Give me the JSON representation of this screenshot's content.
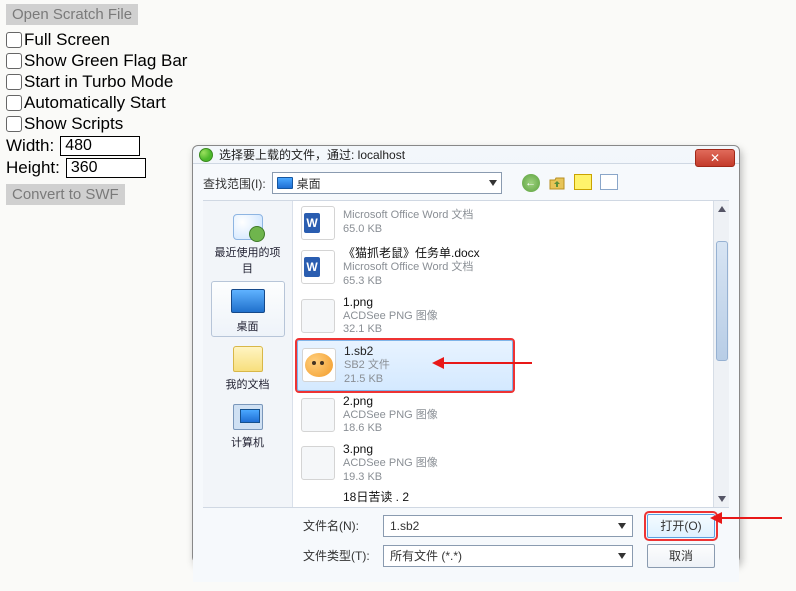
{
  "left": {
    "open_scratch": "Open Scratch File",
    "checkboxes": [
      "Full Screen",
      "Show Green Flag Bar",
      "Start in Turbo Mode",
      "Automatically Start",
      "Show Scripts"
    ],
    "width_label": "Width:",
    "width_value": "480",
    "height_label": "Height:",
    "height_value": "360",
    "convert": "Convert to SWF"
  },
  "dialog": {
    "title": "选择要上载的文件，通过: localhost",
    "lookin_label": "查找范围(I):",
    "lookin_value": "桌面",
    "sidebar": [
      "最近使用的项目",
      "桌面",
      "我的文档",
      "计算机"
    ],
    "files": [
      {
        "name": "",
        "type": "Microsoft Office Word 文档",
        "size": "65.0 KB",
        "kind": "word"
      },
      {
        "name": "《猫抓老鼠》任务单.docx",
        "type": "Microsoft Office Word 文档",
        "size": "65.3 KB",
        "kind": "word"
      },
      {
        "name": "1.png",
        "type": "ACDSee PNG 图像",
        "size": "32.1 KB",
        "kind": "png"
      },
      {
        "name": "1.sb2",
        "type": "SB2 文件",
        "size": "21.5 KB",
        "kind": "sb2",
        "selected": true
      },
      {
        "name": "2.png",
        "type": "ACDSee PNG 图像",
        "size": "18.6 KB",
        "kind": "png"
      },
      {
        "name": "3.png",
        "type": "ACDSee PNG 图像",
        "size": "19.3 KB",
        "kind": "png"
      }
    ],
    "cutoff": "18日苦读 . 2",
    "filename_label": "文件名(N):",
    "filename_value": "1.sb2",
    "filetype_label": "文件类型(T):",
    "filetype_value": "所有文件 (*.*)",
    "open_btn": "打开(O)",
    "cancel_btn": "取消"
  }
}
